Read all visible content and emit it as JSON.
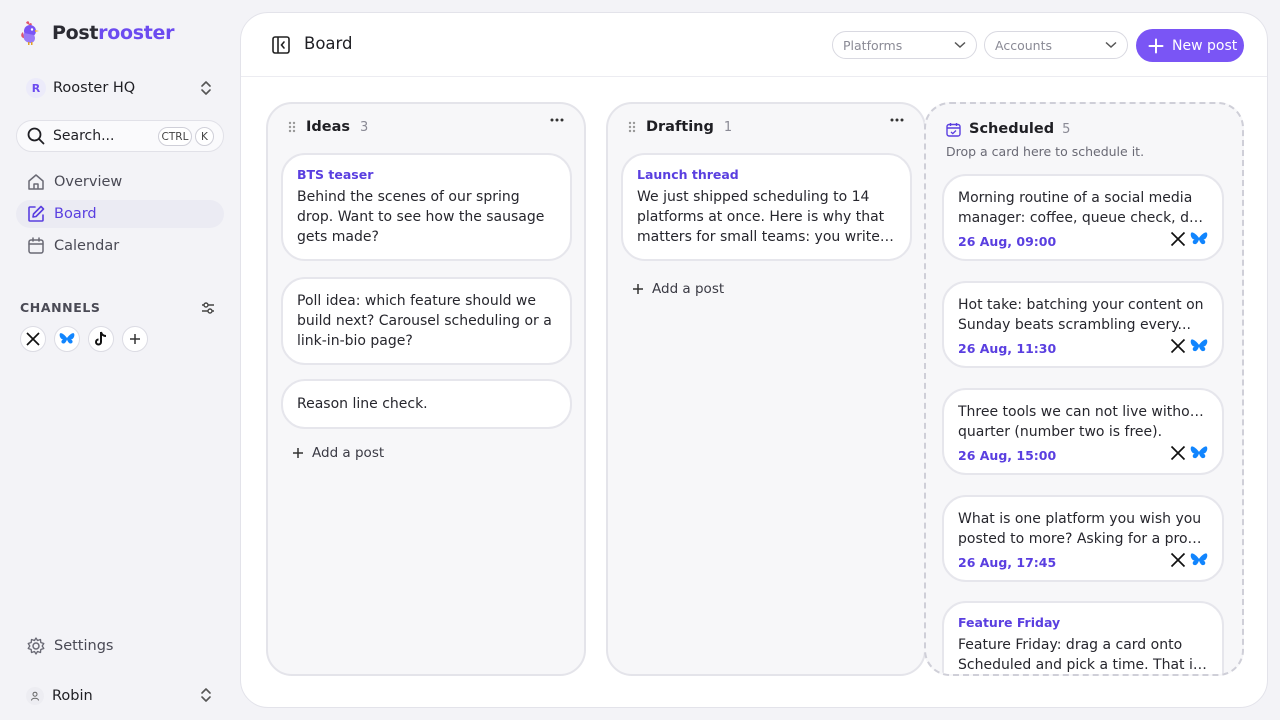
{
  "app": {
    "name_part1": "Post",
    "name_part2": "rooster",
    "accent": "#6c4bf0"
  },
  "workspace": {
    "badge": "R",
    "name": "Rooster HQ"
  },
  "search": {
    "label": "Search...",
    "kbd_ctrl": "CTRL",
    "kbd_k": "K"
  },
  "nav": [
    {
      "label": "Overview",
      "icon": "home-icon",
      "active": false
    },
    {
      "label": "Board",
      "icon": "edit-icon",
      "active": true
    },
    {
      "label": "Calendar",
      "icon": "calendar-icon",
      "active": false
    }
  ],
  "channels": {
    "heading": "CHANNELS",
    "items": [
      "x-icon",
      "bluesky-icon",
      "tiktok-icon",
      "plus-icon"
    ]
  },
  "settings": {
    "label": "Settings"
  },
  "user": {
    "name": "Robin"
  },
  "topbar": {
    "title": "Board",
    "platforms_placeholder": "Platforms",
    "accounts_placeholder": "Accounts",
    "new_post_label": "New post"
  },
  "columns": {
    "ideas": {
      "title": "Ideas",
      "count": "3",
      "cards": [
        {
          "tag": "BTS teaser",
          "text": "Behind the scenes of our spring drop. Want to see how the sausage gets made?"
        },
        {
          "tag": "",
          "text": "Poll idea: which feature should we build next? Carousel scheduling or a link-in-bio page?"
        },
        {
          "tag": "",
          "text": "Reason line check."
        }
      ],
      "add_label": "Add a post"
    },
    "drafting": {
      "title": "Drafting",
      "count": "1",
      "cards": [
        {
          "tag": "Launch thread",
          "line1": "We just shipped scheduling to 14",
          "line2": "platforms at once. Here is why that",
          "line3": "matters for small teams: you write once..."
        }
      ],
      "add_label": "Add a post"
    },
    "scheduled": {
      "title": "Scheduled",
      "count": "5",
      "subtitle": "Drop a card here to schedule it.",
      "cards": [
        {
          "tag": "",
          "line1": "Morning routine of a social media",
          "line2": "manager: coffee, queue check, done by...",
          "time": "26 Aug, 09:00"
        },
        {
          "tag": "",
          "line1": "Hot take: batching your content on",
          "line2": "Sunday beats scrambling every...",
          "time": "26 Aug, 11:30"
        },
        {
          "tag": "",
          "line1": "Three tools we can not live without this",
          "line2": "quarter (number two is free).",
          "time": "26 Aug, 15:00"
        },
        {
          "tag": "",
          "line1": "What is one platform you wish you",
          "line2": "posted to more? Asking for a product...",
          "time": "26 Aug, 17:45"
        },
        {
          "tag": "Feature Friday",
          "line1": "Feature Friday: drag a card onto",
          "line2": "Scheduled and pick a time. That is the...",
          "time": ""
        }
      ]
    }
  }
}
